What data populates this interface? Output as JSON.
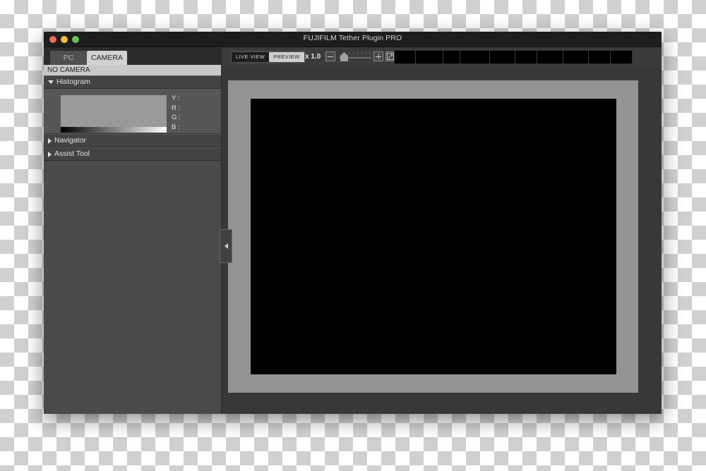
{
  "window": {
    "title": "FUJIFILM Tether Plugin PRO",
    "traffic_lights": {
      "close": "close-button",
      "minimize": "minimize-button",
      "zoom": "zoom-button"
    }
  },
  "sidebar": {
    "tabs": [
      {
        "label": "PC",
        "active": false
      },
      {
        "label": "CAMERA",
        "active": true
      }
    ],
    "camera_status": "NO CAMERA",
    "panels": [
      {
        "label": "Histogram",
        "expanded": true
      },
      {
        "label": "Navigator",
        "expanded": false
      },
      {
        "label": "Assist Tool",
        "expanded": false
      }
    ],
    "histogram": {
      "readouts": [
        {
          "channel": "Y",
          "value": ""
        },
        {
          "channel": "R",
          "value": ""
        },
        {
          "channel": "G",
          "value": ""
        },
        {
          "channel": "B",
          "value": ""
        }
      ],
      "y_label": "Y :",
      "r_label": "R :",
      "g_label": "G :",
      "b_label": "B :",
      "gradient_from": "#000000",
      "gradient_to": "#ffffff",
      "plot_fill": "#9a9a9a"
    },
    "collapse_handle": "◁"
  },
  "toolbar": {
    "view_toggle": {
      "live_view_label": "LIVE VIEW",
      "preview_label": "PREVIEW",
      "selected": "PREVIEW"
    },
    "zoom": {
      "label": "x 1.0",
      "minus_label": "−",
      "plus_label": "+",
      "fit_label": "fit-to-window",
      "value": 1.0,
      "min": 0.5,
      "max": 4.0,
      "tick_count": 6
    },
    "camera_info_segments": [
      {
        "value": ""
      },
      {
        "value": ""
      },
      {
        "value": ""
      },
      {
        "value": ""
      },
      {
        "value": ""
      },
      {
        "value": ""
      },
      {
        "value": ""
      },
      {
        "value": ""
      },
      {
        "value": ""
      },
      {
        "value": ""
      }
    ]
  },
  "preview": {
    "stage_color": "#949494",
    "image_color": "#000000",
    "content": ""
  },
  "colors": {
    "titlebar": "#1d1d1d",
    "sidebar": "#4a4a4a",
    "main": "#383838",
    "accent_active_tab": "#d2d2d2",
    "status_bar": "#c9c9c9"
  }
}
